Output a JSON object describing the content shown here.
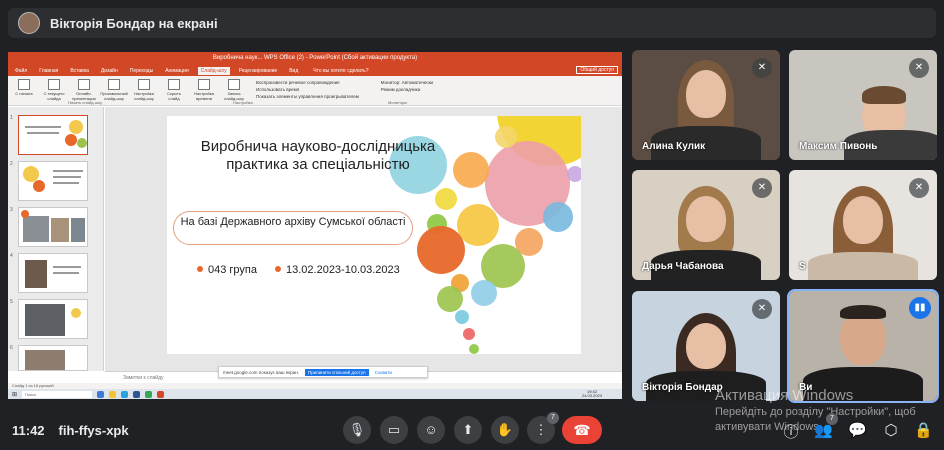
{
  "presenter": {
    "label": "Вікторія Бондар на екрані"
  },
  "shared_screen": {
    "window_title": "Виробнича наук... WPS Office (2) - PowerPoint (Сбой активации продукта)",
    "tabs": [
      "Файл",
      "Главная",
      "Вставка",
      "Дизайн",
      "Переходы",
      "Анимация",
      "Слайд-шоу",
      "Рецензирование",
      "Вид"
    ],
    "active_tab_index": 6,
    "tell_me": "Что вы хотите сделать?",
    "share_button": "Общий доступ",
    "ribbon_buttons": [
      "С начала",
      "С текущего слайда",
      "Онлайн-презентация",
      "Произвольный слайд-шоу",
      "Настройка слайд-шоу",
      "Скрыть слайд",
      "Настройка времени",
      "Запись слайд-шоу"
    ],
    "ribbon_checks": [
      "Воспроизвести речевое сопровождение",
      "Использовать время",
      "Показать элементы управления проигрывателем"
    ],
    "ribbon_monitor": [
      "Монитор: Автоматически",
      "Режим докладчика"
    ],
    "ribbon_groups": [
      "Начать слайд-шоу",
      "Настройка",
      "Мониторы"
    ],
    "slide": {
      "title": "Виробнича науково-дослідницька практика за спеціальністю",
      "subtitle": "На базі Державного архіву Сумської області",
      "group": "043 група",
      "dates": "13.02.2023-10.03.2023"
    },
    "notes_placeholder": "Заметки к слайду",
    "share_notice": {
      "text": "meet.google.com показує ваш екран.",
      "stop_button": "Припинити спільний доступ",
      "hide_button": "Сховати"
    },
    "status": "Слайд 1 из 18    русский",
    "taskbar_search": "Поиск",
    "clock_time": "19:42",
    "clock_date": "24.03.2023",
    "zoom": "107%",
    "lang": "РУС"
  },
  "participants": [
    {
      "name": "Алина Кулик",
      "muted": true
    },
    {
      "name": "Максим Пивонь",
      "muted": true
    },
    {
      "name": "Дарья Чабанова",
      "muted": true
    },
    {
      "name": "S",
      "muted": true
    },
    {
      "name": "Вікторія Бондар",
      "muted": true
    },
    {
      "name": "Ви",
      "muted": false,
      "speaking": true
    }
  ],
  "watermark": {
    "title": "Активация Windows",
    "line1": "Перейдіть до розділу \"Настройки\", щоб",
    "line2": "активувати Windows."
  },
  "bottom_bar": {
    "time": "11:42",
    "meeting_code": "fih-ffys-xpk",
    "more_badge": "7",
    "people_count": "7"
  },
  "colors": {
    "accent": "#1a73e8",
    "end_call": "#ea4335",
    "ppt": "#d24726"
  }
}
